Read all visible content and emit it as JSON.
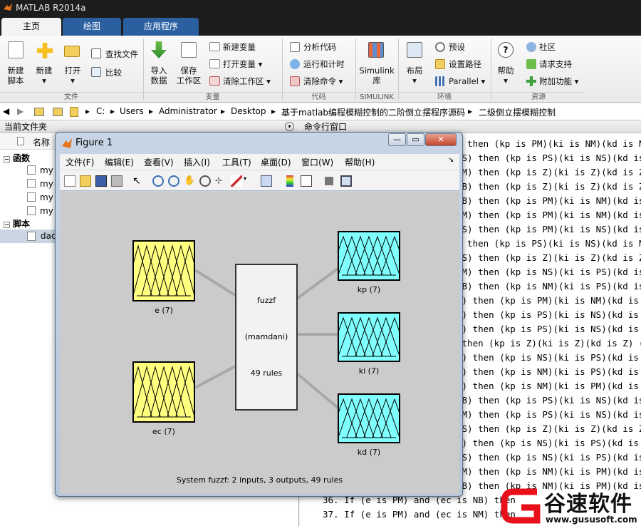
{
  "app": {
    "title": "MATLAB R2014a"
  },
  "tabs": [
    "主页",
    "绘图",
    "应用程序"
  ],
  "ribbon": {
    "new_script": "新建\n脚本",
    "new": "新建",
    "open": "打开",
    "find_files": "查找文件",
    "compare": "比较",
    "group_file": "文件",
    "import_data": "导入\n数据",
    "save_ws": "保存\n工作区",
    "new_var": "新建变量",
    "open_var": "打开变量",
    "clear_ws": "清除工作区",
    "group_var": "变量",
    "analyze": "分析代码",
    "run_time": "运行和计时",
    "clear_cmds": "清除命令",
    "group_code": "代码",
    "simulink": "Simulink\n库",
    "group_simulink": "SIMULINK",
    "layout": "布局",
    "prefs": "预设",
    "set_path": "设置路径",
    "parallel": "Parallel",
    "group_env": "环境",
    "help": "帮助",
    "community": "社区",
    "request_support": "请求支持",
    "addons": "附加功能",
    "group_resources": "资源"
  },
  "address": {
    "parts": [
      "C:",
      "Users",
      "Administrator",
      "Desktop",
      "基于matlab编程模糊控制的二阶倒立摆程序源码",
      "二级倒立摆模糊控制"
    ]
  },
  "current_folder": {
    "title": "当前文件夹",
    "col_name": "名称",
    "section_functions": "函数",
    "section_scripts": "脚本",
    "items": [
      "my",
      "my",
      "my",
      "my"
    ],
    "script_item": "dac"
  },
  "command_window": {
    "title": "命令行窗口",
    "lines": [
      ") then (kp is PM)(ki is NM)(kd is N",
      "PS) then (kp is PS)(ki is NS)(kd is",
      "PM) then (kp is Z)(ki is Z)(kd is Z)",
      "PB) then (kp is Z)(ki is Z)(kd is Z)",
      "NB) then (kp is PM)(ki is NM)(kd is",
      "NM) then (kp is PM)(ki is NM)(kd is",
      "NS) then (kp is PM)(ki is NS)(kd is",
      ") then (kp is PS)(ki is NS)(kd is N",
      "PS) then (kp is Z)(ki is Z)(kd is Z)",
      "PM) then (kp is NS)(ki is PS)(kd is",
      "PB) then (kp is NM)(ki is PS)(kd is",
      "B) then (kp is PM)(ki is NM)(kd is N",
      "M) then (kp is PS)(ki is NS)(kd is N",
      "S) then (kp is PS)(ki is NS)(kd is N",
      " then (kp is Z)(ki is Z)(kd is Z) (",
      "S) then (kp is NS)(ki is PS)(kd is",
      "M) then (kp is NM)(ki is PS)(kd is",
      "B) then (kp is NM)(ki is PM)(kd is",
      "NB) then (kp is PS)(ki is NS)(kd is",
      "NM) then (kp is PS)(ki is NS)(kd is",
      "NS) then (kp is Z)(ki is Z)(kd is Z)",
      "Z) then (kp is NS)(ki is PS)(kd is Z",
      "PS) then (kp is NS)(ki is PS)(kd is",
      "PM) then (kp is NM)(ki is PM)(kd is",
      "PB) then (kp is NM)(ki is PM)(kd is",
      "36. If (e is PM) and (ec is NB) then",
      "37. If (e is PM) and (ec is NM) then"
    ]
  },
  "figure": {
    "title": "Figure 1",
    "menus": [
      "文件(F)",
      "编辑(E)",
      "查看(V)",
      "插入(I)",
      "工具(T)",
      "桌面(D)",
      "窗口(W)",
      "帮助(H)"
    ],
    "inputs": [
      {
        "name": "e (7)"
      },
      {
        "name": "ec (7)"
      }
    ],
    "outputs": [
      {
        "name": "kp (7)"
      },
      {
        "name": "ki (7)"
      },
      {
        "name": "kd (7)"
      }
    ],
    "system_name": "fuzzf",
    "system_type": "(mamdani)",
    "rules": "49 rules",
    "summary": "System fuzzf: 2 inputs, 3 outputs, 49 rules"
  },
  "watermark": {
    "brand": "谷速软件",
    "url": "www.gususoft.com"
  },
  "colors": {
    "input_fill": "#ffff80",
    "output_fill": "#80ffff",
    "tab_active": "#f3f3f3"
  }
}
